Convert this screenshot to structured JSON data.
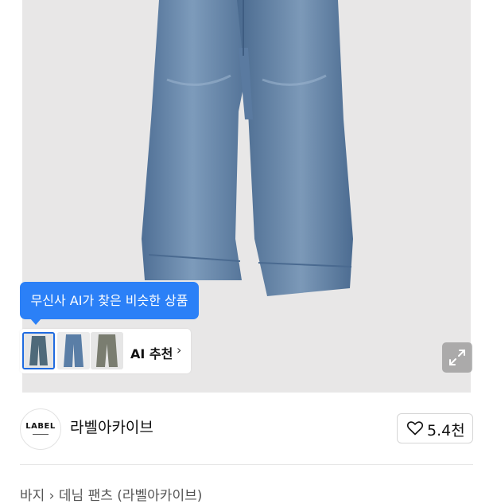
{
  "product_image": {
    "ai_tooltip": "무신사 AI가 찾은 비슷한 상품",
    "ai_card": {
      "label": "AI 추천",
      "arrow": "›",
      "thumbnails": [
        "jeans-thumb-1",
        "jeans-thumb-2",
        "jeans-thumb-3"
      ]
    },
    "expand_icon": "expand-arrows-icon"
  },
  "seller": {
    "logo_text": "LABEL",
    "name": "라벨아카이브",
    "likes": "5.4천",
    "like_icon": "heart-outline-icon"
  },
  "breadcrumb": "바지 › 데님 팬츠 (라벨아카이브)",
  "colors": {
    "accent": "#2b80f7",
    "selected_border": "#1f6be0",
    "image_bg": "#e8e7e7",
    "denim": "#5b7fa6"
  }
}
